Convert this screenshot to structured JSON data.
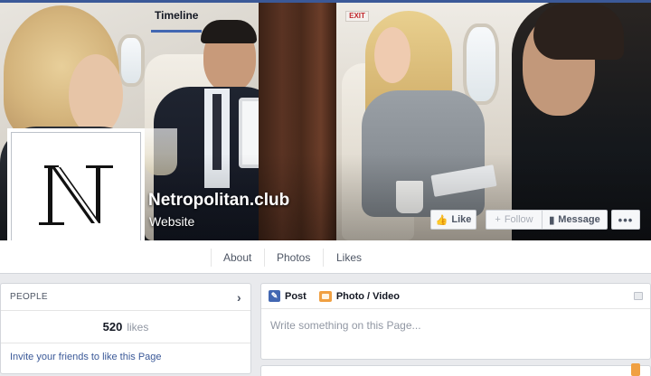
{
  "page": {
    "name": "Netropolitan.club",
    "category": "Website",
    "logo_letter": "N"
  },
  "cover": {
    "exit_sign": "EXIT"
  },
  "actions": {
    "like": "Like",
    "follow": "Follow",
    "message": "Message",
    "more": "•••"
  },
  "tabs": [
    {
      "label": "Timeline",
      "active": true
    },
    {
      "label": "About",
      "active": false
    },
    {
      "label": "Photos",
      "active": false
    },
    {
      "label": "Likes",
      "active": false
    }
  ],
  "people": {
    "header": "PEOPLE",
    "likes_count": "520",
    "likes_label": "likes",
    "invite_text": "Invite your friends to like this Page"
  },
  "composer": {
    "post_label": "Post",
    "photo_label": "Photo / Video",
    "placeholder": "Write something on this Page..."
  },
  "colors": {
    "accent": "#3b5998",
    "tab_underline": "#4267b2",
    "photo_icon": "#f0a042"
  }
}
